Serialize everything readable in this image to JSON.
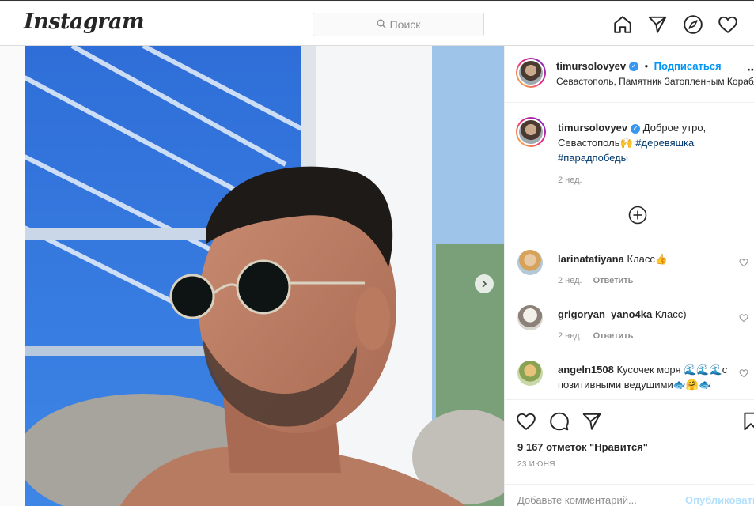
{
  "app": {
    "logo_text": "Instagram"
  },
  "search": {
    "placeholder": "Поиск"
  },
  "nav": {
    "icons": [
      "home-icon",
      "direct-icon",
      "explore-icon",
      "activity-heart-icon"
    ]
  },
  "post": {
    "username": "timursolovyev",
    "follow_label": "Подписаться",
    "separator": "•",
    "location": "Севастополь, Памятник Затопленным Кораблям",
    "caption": {
      "username": "timursolovyev",
      "text_1": " Доброе утро, Севастополь🙌 ",
      "tag_1": "#деревяшка",
      "tag_2": "#парадпобеды",
      "time": "2 нед."
    },
    "comments": [
      {
        "username": "larinatatiyana",
        "text": " Класс👍",
        "time": "2 нед.",
        "reply": "Ответить"
      },
      {
        "username": "grigoryan_yano4ka",
        "text": " Класс)",
        "time": "2 нед.",
        "reply": "Ответить"
      },
      {
        "username": "angeln1508",
        "text": " Кусочек моря 🌊🌊🌊с позитивными ведущими🐟🤗🐟"
      }
    ],
    "likes": "9 167 отметок \"Нравится\"",
    "date": "23 июня",
    "add_comment_placeholder": "Добавьте комментарий...",
    "publish_label": "Опубликовать"
  },
  "colors": {
    "accent": "#0095f6",
    "tag": "#00376b",
    "muted": "#8e8e8e"
  }
}
